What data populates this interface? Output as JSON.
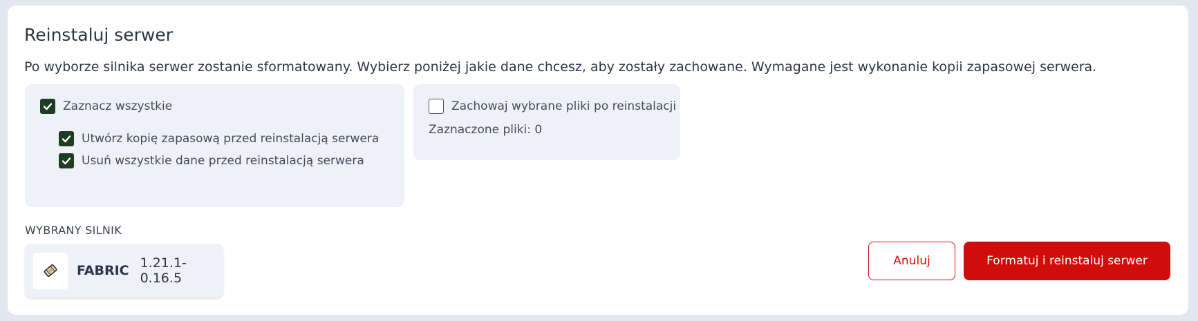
{
  "dialog": {
    "title": "Reinstaluj serwer",
    "description": "Po wyborze silnika serwer zostanie sformatowany. Wybierz poniżej jakie dane chcesz, aby zostały zachowane. Wymagane jest wykonanie kopii zapasowej serwera."
  },
  "options": {
    "select_all": {
      "label": "Zaznacz wszystkie",
      "checked": true
    },
    "backup": {
      "label": "Utwórz kopię zapasową przed reinstalacją serwera",
      "checked": true
    },
    "delete_all": {
      "label": "Usuń wszystkie dane przed reinstalacją serwera",
      "checked": true
    }
  },
  "files": {
    "keep_files": {
      "label": "Zachowaj wybrane pliki po reinstalacji",
      "checked": false
    },
    "selected_count_text": "Zaznaczone pliki: 0"
  },
  "engine": {
    "section_label": "WYBRANY SILNIK",
    "name": "FABRIC",
    "version": "1.21.1-0.16.5",
    "icon": "fabric-logo-icon"
  },
  "actions": {
    "cancel_label": "Anuluj",
    "confirm_label": "Formatuj i reinstaluj serwer"
  },
  "colors": {
    "accent": "#d10c0c",
    "checkbox_checked": "#1f3d23",
    "panel_bg": "#eef1f8"
  }
}
